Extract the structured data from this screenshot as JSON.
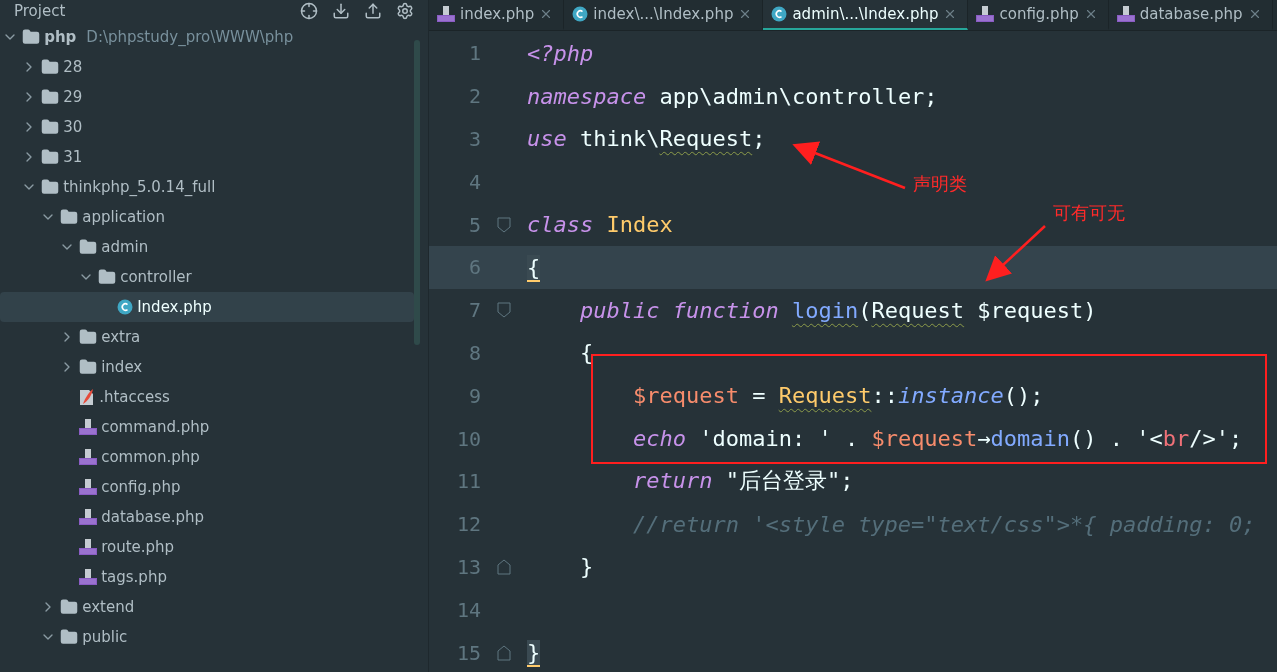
{
  "sidebar": {
    "title": "Project",
    "tree": [
      {
        "name": "php",
        "hint": "D:\\phpstudy_pro\\WWW\\php",
        "kind": "root",
        "expanded": true,
        "selected": false,
        "children": [
          {
            "name": "28",
            "kind": "folder",
            "expanded": false,
            "selected": false
          },
          {
            "name": "29",
            "kind": "folder",
            "expanded": false,
            "selected": false
          },
          {
            "name": "30",
            "kind": "folder",
            "expanded": false,
            "selected": false
          },
          {
            "name": "31",
            "kind": "folder",
            "expanded": false,
            "selected": false
          },
          {
            "name": "thinkphp_5.0.14_full",
            "kind": "folder",
            "expanded": true,
            "selected": false,
            "children": [
              {
                "name": "application",
                "kind": "folder",
                "expanded": true,
                "selected": false,
                "children": [
                  {
                    "name": "admin",
                    "kind": "folder",
                    "expanded": true,
                    "selected": false,
                    "children": [
                      {
                        "name": "controller",
                        "kind": "folder",
                        "expanded": true,
                        "selected": false,
                        "children": [
                          {
                            "name": "Index.php",
                            "kind": "class",
                            "selected": true
                          }
                        ]
                      }
                    ]
                  },
                  {
                    "name": "extra",
                    "kind": "folder",
                    "expanded": false,
                    "selected": false
                  },
                  {
                    "name": "index",
                    "kind": "folder",
                    "expanded": false,
                    "selected": false
                  },
                  {
                    "name": ".htaccess",
                    "kind": "htaccess",
                    "selected": false
                  },
                  {
                    "name": "command.php",
                    "kind": "php",
                    "selected": false
                  },
                  {
                    "name": "common.php",
                    "kind": "php",
                    "selected": false
                  },
                  {
                    "name": "config.php",
                    "kind": "php",
                    "selected": false
                  },
                  {
                    "name": "database.php",
                    "kind": "php",
                    "selected": false
                  },
                  {
                    "name": "route.php",
                    "kind": "php",
                    "selected": false
                  },
                  {
                    "name": "tags.php",
                    "kind": "php",
                    "selected": false
                  }
                ]
              },
              {
                "name": "extend",
                "kind": "folder",
                "expanded": false,
                "selected": false
              },
              {
                "name": "public",
                "kind": "folder",
                "expanded": true,
                "selected": false
              }
            ]
          }
        ]
      }
    ]
  },
  "tabs": [
    {
      "label": "index.php",
      "kind": "php",
      "selected": false
    },
    {
      "label": "index\\...\\Index.php",
      "kind": "class",
      "selected": false
    },
    {
      "label": "admin\\...\\Index.php",
      "kind": "class",
      "selected": true
    },
    {
      "label": "config.php",
      "kind": "php",
      "selected": false
    },
    {
      "label": "database.php",
      "kind": "php",
      "selected": false
    }
  ],
  "editor": {
    "lines": [
      {
        "number": "1",
        "current": false,
        "tokens": [
          {
            "kind": "keyword",
            "text": "<?php"
          }
        ]
      },
      {
        "number": "2",
        "current": false,
        "tokens": [
          {
            "kind": "keyword",
            "text": "namespace"
          },
          {
            "kind": "plain",
            "text": " app\\admin\\controller;"
          }
        ]
      },
      {
        "number": "3",
        "current": false,
        "tokens": [
          {
            "kind": "keyword",
            "text": "use"
          },
          {
            "kind": "plain",
            "text": " think\\"
          },
          {
            "kind": "warn",
            "text": "Request"
          },
          {
            "kind": "plain",
            "text": ";"
          }
        ]
      },
      {
        "number": "4",
        "current": false
      },
      {
        "number": "5",
        "current": false,
        "fold": {
          "kind": "start"
        },
        "tokens": [
          {
            "kind": "keyword",
            "text": "class "
          },
          {
            "kind": "classname",
            "text": "Index"
          }
        ]
      },
      {
        "number": "6",
        "current": true,
        "tokens": [
          {
            "kind": "brace",
            "text": "{"
          }
        ]
      },
      {
        "number": "7",
        "current": false,
        "fold": {
          "kind": "start"
        },
        "tokens": [
          {
            "kind": "keyword",
            "text": "    public function "
          },
          {
            "kind": "funcwarn",
            "text": "login"
          },
          {
            "kind": "plain",
            "text": "("
          },
          {
            "kind": "warn",
            "text": "Request"
          },
          {
            "kind": "plain",
            "text": " $request)"
          }
        ]
      },
      {
        "number": "8",
        "current": false,
        "tokens": [
          {
            "kind": "plain",
            "text": "    {"
          }
        ]
      },
      {
        "number": "9",
        "current": false,
        "tokens": [
          {
            "kind": "variable",
            "text": "        $request"
          },
          {
            "kind": "plain",
            "text": " = "
          },
          {
            "kind": "classwarn",
            "text": "Request"
          },
          {
            "kind": "plain",
            "text": "::"
          },
          {
            "kind": "staticcall",
            "text": "instance"
          },
          {
            "kind": "plain",
            "text": "();"
          }
        ]
      },
      {
        "number": "10",
        "current": false,
        "tokens": [
          {
            "kind": "keyword",
            "text": "        echo"
          },
          {
            "kind": "plain",
            "text": " 'domain: ' . "
          },
          {
            "kind": "variable",
            "text": "$request"
          },
          {
            "kind": "plain",
            "text": "→"
          },
          {
            "kind": "function",
            "text": "domain"
          },
          {
            "kind": "plain",
            "text": "() . '<"
          },
          {
            "kind": "tag",
            "text": "br"
          },
          {
            "kind": "plain",
            "text": "/>';"
          }
        ]
      },
      {
        "number": "11",
        "current": false,
        "tokens": [
          {
            "kind": "keyword",
            "text": "        return"
          },
          {
            "kind": "plain",
            "text": " \"后台登录\";"
          }
        ]
      },
      {
        "number": "12",
        "current": false,
        "tokens": [
          {
            "kind": "comment",
            "text": "        //return '<style type=\"text/css\">*{ padding: 0;"
          }
        ]
      },
      {
        "number": "13",
        "current": false,
        "fold": {
          "kind": "end"
        },
        "tokens": [
          {
            "kind": "plain",
            "text": "    }"
          }
        ]
      },
      {
        "number": "14",
        "current": false
      },
      {
        "number": "15",
        "current": false,
        "fold": {
          "kind": "end"
        },
        "tokens": [
          {
            "kind": "brace",
            "text": "}"
          }
        ]
      }
    ]
  },
  "annotations": [
    {
      "text": "声明类"
    },
    {
      "text": "可有可无"
    }
  ]
}
